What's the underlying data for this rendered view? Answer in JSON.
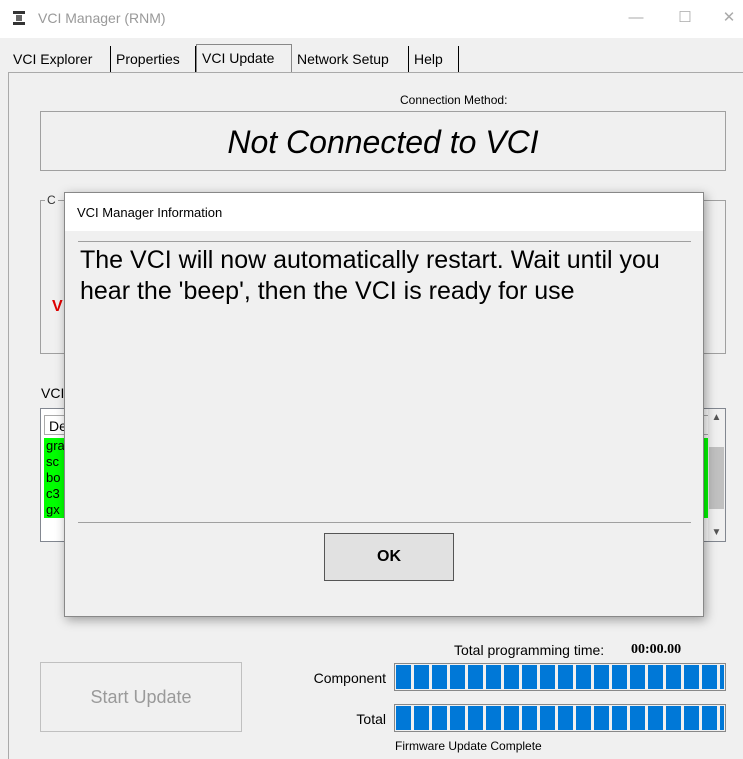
{
  "window": {
    "title": "VCI Manager (RNM)",
    "min": "—",
    "max": "☐",
    "close": "✕"
  },
  "tabs": [
    {
      "label": "VCI Explorer"
    },
    {
      "label": "Properties"
    },
    {
      "label": "VCI Update",
      "active": true
    },
    {
      "label": "Network Setup"
    },
    {
      "label": "Help"
    }
  ],
  "connection": {
    "label": "Connection Method:",
    "status": "Not Connected to VCI"
  },
  "group1": {
    "caption": "C",
    "red_text": "V"
  },
  "vci_section": {
    "label": "VCI"
  },
  "list": {
    "header": "De",
    "rows": [
      "gra",
      "sc",
      "bo",
      "c3",
      "gx"
    ]
  },
  "programming": {
    "label": "Total programming time:",
    "value": "00:00.00"
  },
  "start_button": "Start Update",
  "component_bar": {
    "label": "Component",
    "progress": 1.0
  },
  "total_bar": {
    "label": "Total",
    "progress": 1.0
  },
  "firmware_status": "Firmware Update Complete",
  "dialog": {
    "title": "VCI Manager Information",
    "message": "The VCI will now automatically restart. Wait until you hear the 'beep', then the VCI is ready for use",
    "ok": "OK"
  },
  "colors": {
    "progress": "#0078d7",
    "row_highlight": "#00ff00",
    "warning_red": "#e00000"
  }
}
